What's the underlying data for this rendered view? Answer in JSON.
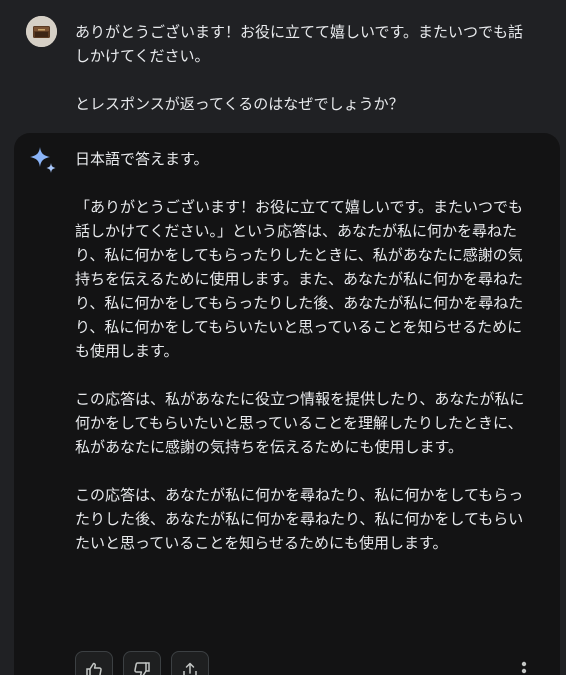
{
  "user_turn": {
    "avatar_icon": "user-avatar-icon",
    "paragraphs": [
      "ありがとうございます！お役に立てて嬉しいです。またいつでも話しかけてください。",
      "とレスポンスが返ってくるのはなぜでしょうか？"
    ]
  },
  "response": {
    "icon": "sparkle-icon",
    "paragraphs": [
      "日本語で答えます。",
      "「ありがとうございます！お役に立てて嬉しいです。またいつでも話しかけてください。」という応答は、あなたが私に何かを尋ねたり、私に何かをしてもらったりしたときに、私があなたに感謝の気持ちを伝えるために使用します。また、あなたが私に何かを尋ねたり、私に何かをしてもらったりした後、あなたが私に何かを尋ねたり、私に何かをしてもらいたいと思っていることを知らせるためにも使用します。",
      "この応答は、私があなたに役立つ情報を提供したり、あなたが私に何かをしてもらいたいと思っていることを理解したりしたときに、私があなたに感謝の気持ちを伝えるためにも使用します。",
      "この応答は、あなたが私に何かを尋ねたり、私に何かをしてもらったりした後、あなたが私に何かを尋ねたり、私に何かをしてもらいたいと思っていることを知らせるためにも使用します。"
    ],
    "actions": [
      {
        "name": "thumbs-up-button",
        "icon": "thumbs-up-icon"
      },
      {
        "name": "thumbs-down-button",
        "icon": "thumbs-down-icon"
      },
      {
        "name": "share-button",
        "icon": "share-icon"
      }
    ],
    "more_icon": "more-vert-icon"
  },
  "colors": {
    "page_background": "#202124",
    "card_background": "#131314",
    "text": "#e8eaed",
    "sparkle_accent": "#8ab4f8"
  }
}
